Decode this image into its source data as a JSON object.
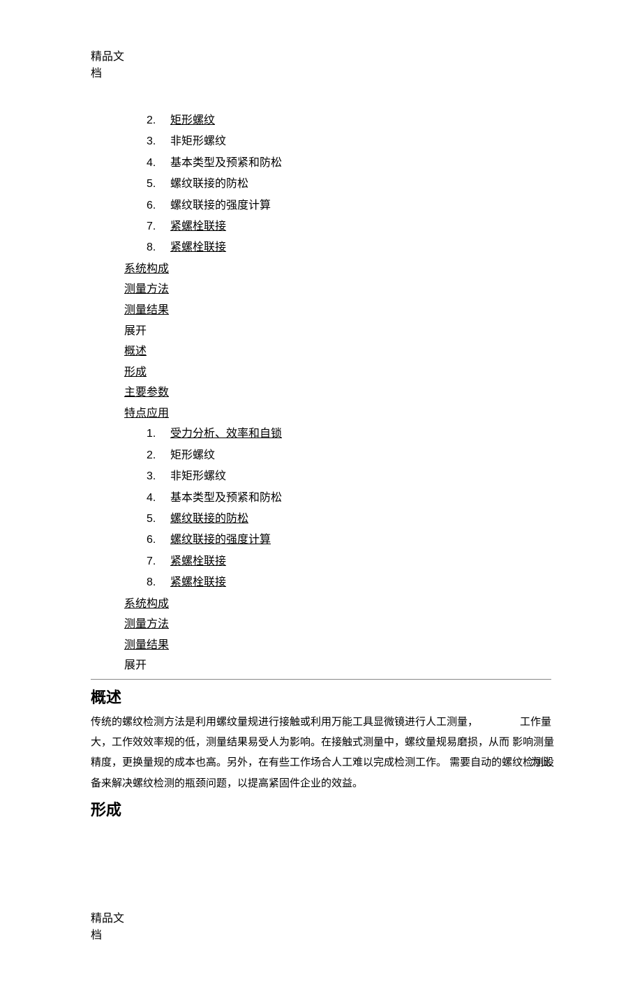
{
  "header": "精品文档",
  "footer": "精品文档",
  "list1": [
    {
      "n": "2.",
      "label": "矩形螺纹",
      "u": true
    },
    {
      "n": "3.",
      "label": "非矩形螺纹",
      "u": false
    },
    {
      "n": "4.",
      "label": "基本类型及预紧和防松",
      "u": false
    },
    {
      "n": "5.",
      "label": "螺纹联接的防松",
      "u": false
    },
    {
      "n": "6.",
      "label": "螺纹联接的强度计算",
      "u": false
    },
    {
      "n": "7.",
      "label": "紧螺栓联接",
      "u": true
    },
    {
      "n": "8.",
      "label": "紧螺栓联接",
      "u": true
    }
  ],
  "group1": [
    {
      "label": "系统构成",
      "u": true
    },
    {
      "label": "测量方法",
      "u": true
    },
    {
      "label": "测量结果",
      "u": true
    },
    {
      "label": "展开",
      "u": false
    },
    {
      "label": "概述",
      "u": true
    },
    {
      "label": "形成",
      "u": true
    },
    {
      "label": "主要参数",
      "u": true
    },
    {
      "label": "特点应用",
      "u": true
    }
  ],
  "list2": [
    {
      "n": "1.",
      "label": "受力分析、效率和自锁",
      "u": true
    },
    {
      "n": "2.",
      "label": "矩形螺纹",
      "u": false
    },
    {
      "n": "3.",
      "label": "非矩形螺纹",
      "u": false
    },
    {
      "n": "4.",
      "label": "基本类型及预紧和防松",
      "u": false
    },
    {
      "n": "5.",
      "label": "螺纹联接的防松",
      "u": true
    },
    {
      "n": "6.",
      "label": "螺纹联接的强度计算",
      "u": true
    },
    {
      "n": "7.",
      "label": "紧螺栓联接",
      "u": true
    },
    {
      "n": "8.",
      "label": "紧螺栓联接",
      "u": true
    }
  ],
  "group2": [
    {
      "label": "系统构成",
      "u": true
    },
    {
      "label": "测量方法",
      "u": true
    },
    {
      "label": "测量结果",
      "u": true
    },
    {
      "label": "展开",
      "u": false
    }
  ],
  "section1": {
    "title": "概述",
    "body_main": "传统的螺纹检测方法是利用螺纹量规进行接触或利用万能工具显微镜进行人工测量，\n大，工作效效率规的低，测量结果易受人为影响。在接触式测量中，螺纹量规易磨损，从而 影响测量精度，更换量规的成本也高。另外，在有些工作场合人工难以完成检测工作。 需要自动的螺纹检测设备来解决螺纹检测的瓶颈问题，以提高紧固件企业的效益。",
    "side1": "工作量",
    "side2": "为此"
  },
  "section2": {
    "title": "形成"
  }
}
